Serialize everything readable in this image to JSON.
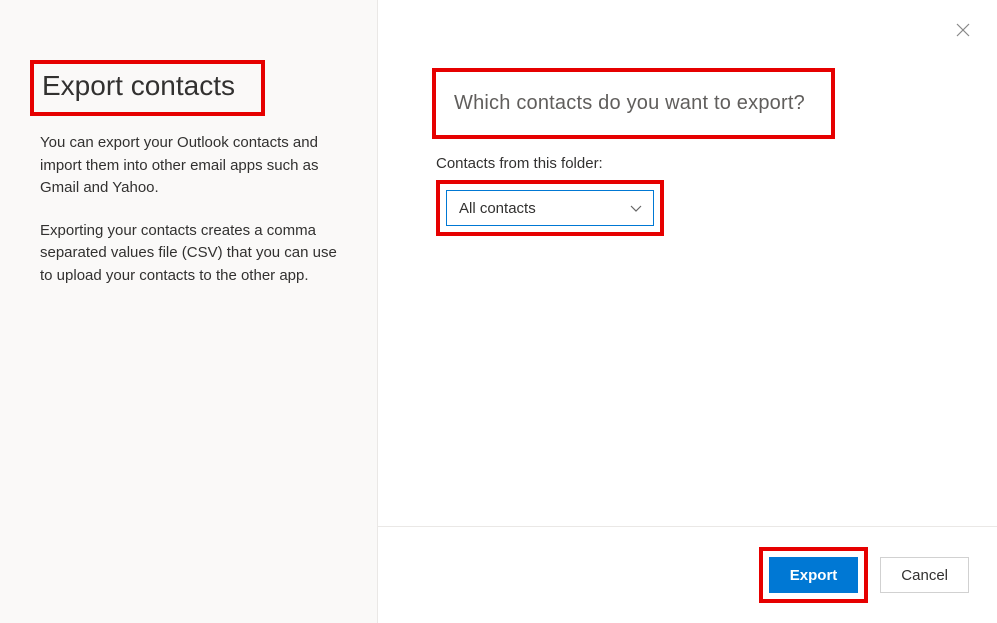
{
  "dialog": {
    "title": "Export contacts",
    "description1": "You can export your Outlook contacts and import them into other email apps such as Gmail and Yahoo.",
    "description2": "Exporting your contacts creates a comma separated values file (CSV) that you can use to upload your contacts to the other app.",
    "question": "Which contacts do you want to export?",
    "folder_label": "Contacts from this folder:",
    "folder_selected": "All contacts",
    "export_label": "Export",
    "cancel_label": "Cancel"
  }
}
